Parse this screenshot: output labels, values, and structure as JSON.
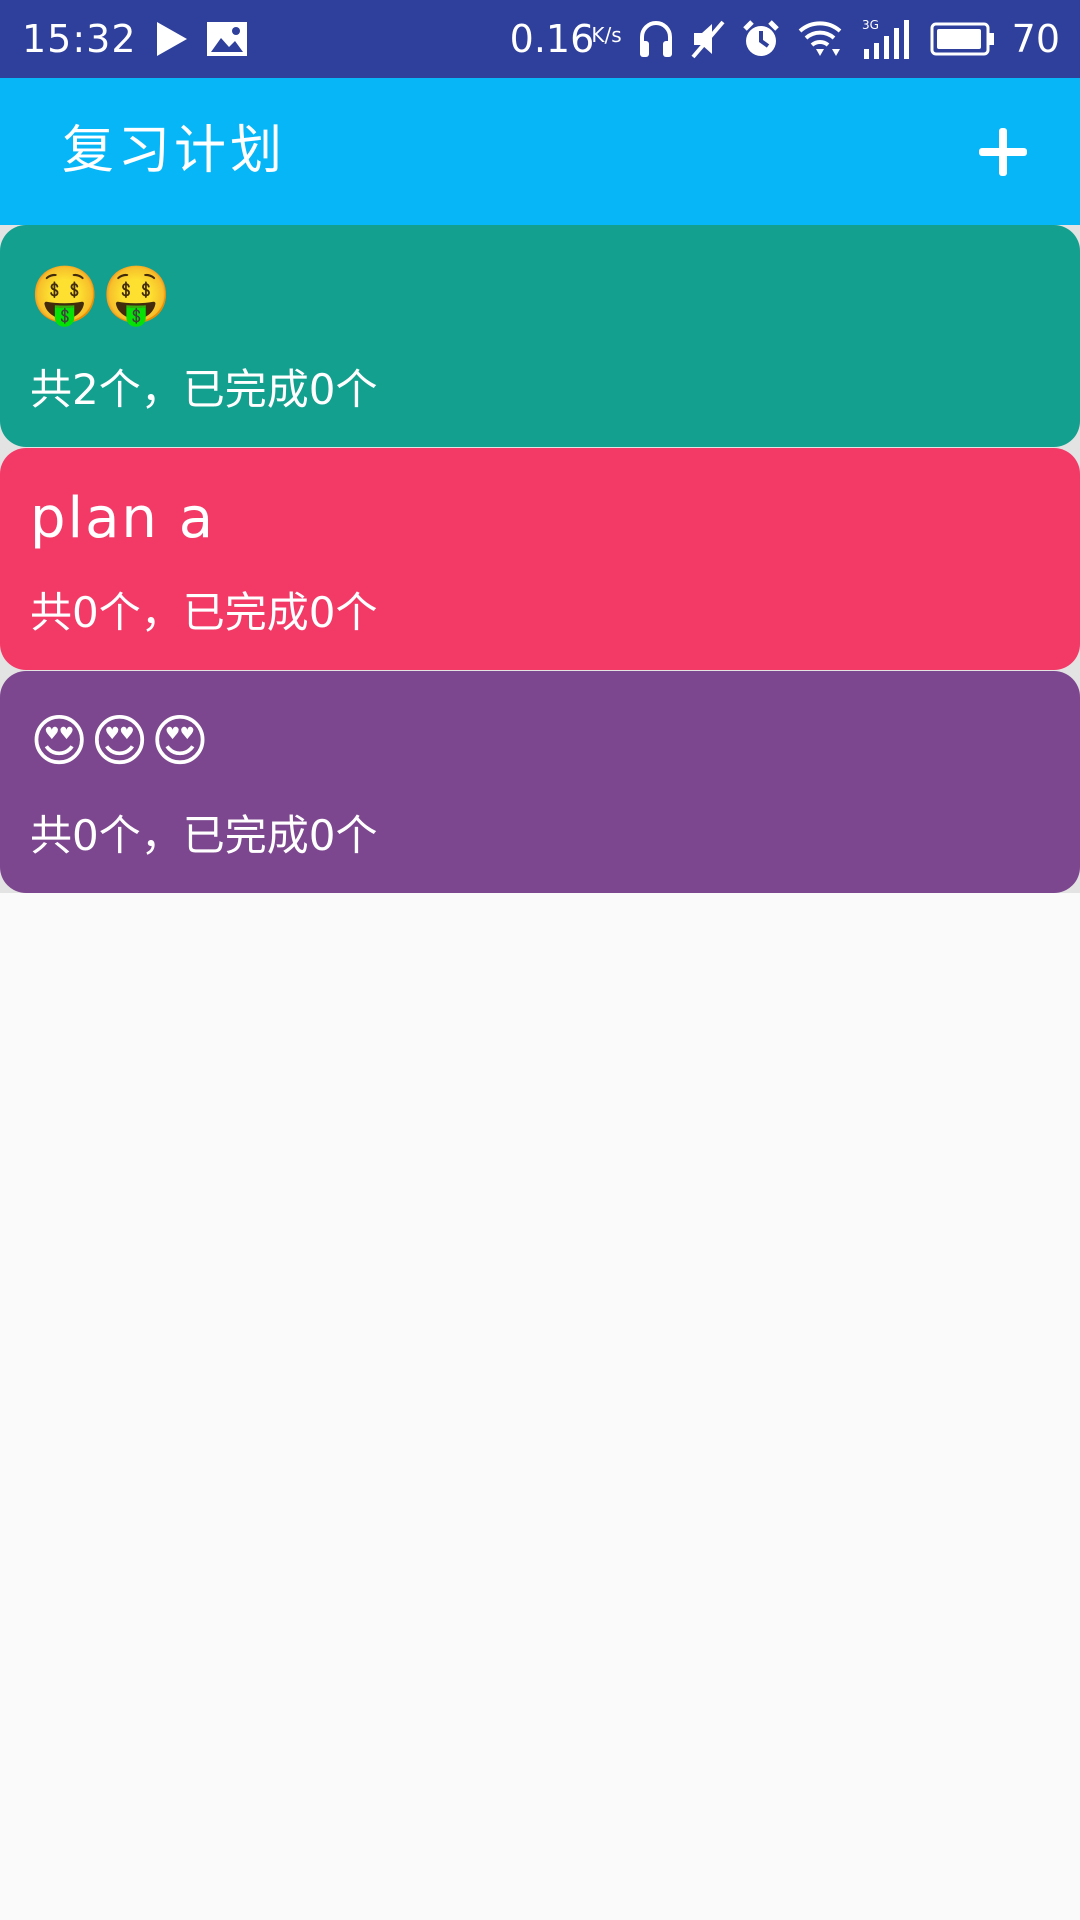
{
  "status_bar": {
    "time": "15:32",
    "net_speed": "0.16",
    "net_speed_unit": "K/s",
    "network_type": "3G",
    "battery_percent": "70"
  },
  "app_bar": {
    "title": "复习计划",
    "add_icon": "plus-icon"
  },
  "plans": [
    {
      "title": "🤑🤑",
      "summary": "共2个，已完成0个",
      "color": "#13a08f"
    },
    {
      "title": "plan a",
      "summary": "共0个，已完成0个",
      "color": "#f33a67"
    },
    {
      "title": "😍😍😍",
      "summary": "共0个，已完成0个",
      "color": "#7c478e"
    }
  ],
  "colors": {
    "status_bar": "#2e3f9c",
    "app_bar": "#07b6f6",
    "background": "#fafafa"
  }
}
